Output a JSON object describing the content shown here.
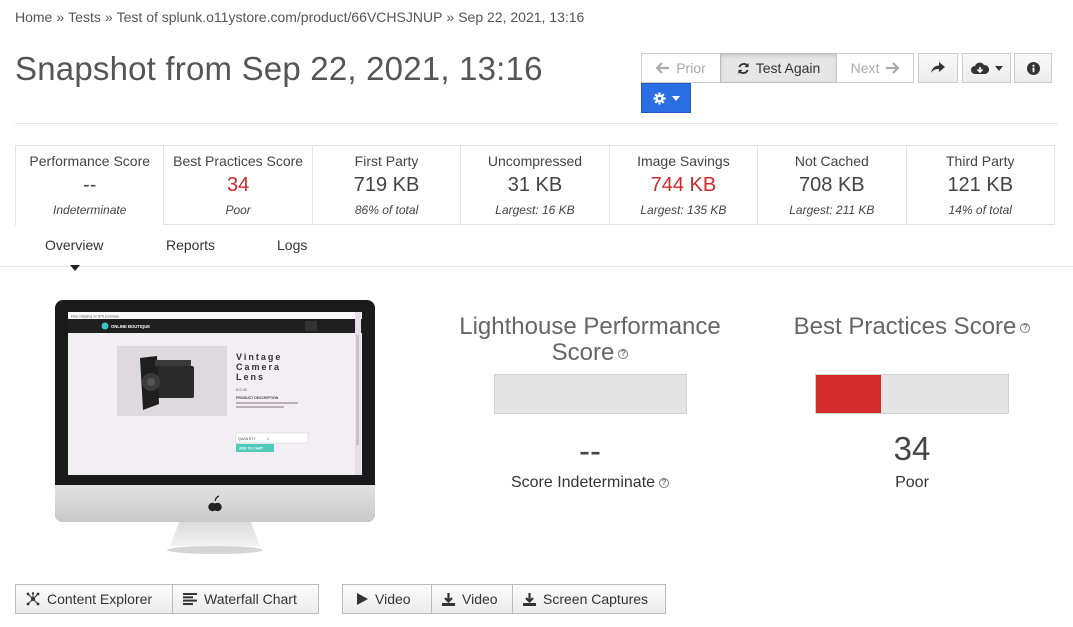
{
  "breadcrumb": {
    "home": "Home",
    "tests": "Tests",
    "test": "Test of splunk.o11ystore.com/product/66VCHSJNUP",
    "date": "Sep 22, 2021, 13:16",
    "separator": "»"
  },
  "title": "Snapshot from Sep 22, 2021, 13:16",
  "toolbar": {
    "prior_label": "Prior",
    "test_again_label": "Test Again",
    "next_label": "Next"
  },
  "metrics": [
    {
      "label": "Performance Score",
      "value": "--",
      "sub": "Indeterminate"
    },
    {
      "label": "Best Practices Score",
      "value": "34",
      "sub": "Poor"
    },
    {
      "label": "First Party",
      "value": "719 KB",
      "sub": "86% of total"
    },
    {
      "label": "Uncompressed",
      "value": "31 KB",
      "sub": "Largest: 16 KB"
    },
    {
      "label": "Image Savings",
      "value": "744 KB",
      "sub": "Largest: 135 KB"
    },
    {
      "label": "Not Cached",
      "value": "708 KB",
      "sub": "Largest: 211 KB"
    },
    {
      "label": "Third Party",
      "value": "121 KB",
      "sub": "14% of total"
    }
  ],
  "tabs": [
    {
      "label": "Overview"
    },
    {
      "label": "Reports"
    },
    {
      "label": "Logs"
    }
  ],
  "screenshot": {
    "banner": "Free shipping on $75 purchase",
    "logo": "ONLINE BOUTIQUE",
    "product_name": "Vintage Camera Lens",
    "price": "$12.48",
    "desc_heading": "PRODUCT DESCRIPTION",
    "desc_text": "You won't have a camera to use it and it probably doesn't work anyway.",
    "quantity_label": "QUANTITY",
    "quantity_value": "1",
    "add_to_cart": "ADD TO CART"
  },
  "lighthouse": {
    "title_line1": "Lighthouse Performance",
    "title_line2": "Score",
    "value": "--",
    "desc": "Score Indeterminate",
    "fill_fraction": 0
  },
  "best_practices": {
    "title": "Best Practices Score",
    "value": "34",
    "desc": "Poor",
    "fill_fraction": 0.34
  },
  "bottom_buttons": {
    "content_explorer": "Content Explorer",
    "waterfall_chart": "Waterfall Chart",
    "video_play": "Video",
    "video_download": "Video",
    "screen_captures": "Screen Captures"
  },
  "colors": {
    "accent_blue": "#2b6de3",
    "poor_red": "#cc2b2b",
    "bar_red": "#d42b2b"
  }
}
